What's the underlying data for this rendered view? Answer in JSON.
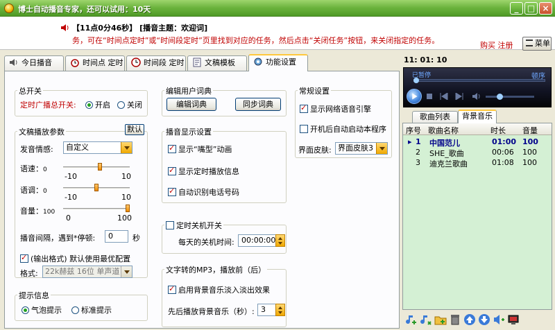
{
  "window": {
    "title": "博士自动播音专家，还可以试用：10天"
  },
  "notice": {
    "line1": "【11点0分46秒】 [播音主题：欢迎词]",
    "line2": "务，可在“时间点定时”或“时间段定时”页里找到对应的任务，然后点击“关闭任务”按钮，来关闭指定的任务。",
    "buy": "购买",
    "register": "注册",
    "menu": "菜单"
  },
  "tabs": [
    {
      "label": "今日播音",
      "icon": "speaker-icon"
    },
    {
      "label": "时间点 定时",
      "icon": "alarm-clock-icon"
    },
    {
      "label": "时间段 定时",
      "icon": "clock-icon"
    },
    {
      "label": "文稿模板",
      "icon": "document-icon"
    },
    {
      "label": "功能设置",
      "icon": "gear-icon",
      "active": true
    }
  ],
  "master": {
    "title": "总开关",
    "label": "定时广播总开关:",
    "on": "开启",
    "off": "关闭",
    "selected": "on"
  },
  "playback": {
    "title": "文稿播放参数",
    "default_btn": "默认",
    "emotion_label": "发音情感:",
    "emotion_value": "自定义",
    "speed": {
      "label": "语速：",
      "zero": "0",
      "min": "-10",
      "max": "10",
      "value": 1
    },
    "pitch": {
      "label": "语调：",
      "zero": "0",
      "min": "-10",
      "max": "10",
      "value": 0
    },
    "volume": {
      "label": "音量：",
      "hundred": "100",
      "min": "0",
      "max": "100",
      "value": 100
    },
    "interval_label": "播音间隔，遇到*停顿:",
    "interval_value": "0",
    "interval_unit": "秒",
    "output_check": "(输出格式) 默认使用最优配置",
    "format_label": "格式:",
    "format_value": "22k赫兹 16位 单声道"
  },
  "tips": {
    "title": "提示信息",
    "bubble": "气泡提示",
    "standard": "标准提示",
    "selected": "bubble"
  },
  "dict": {
    "title": "编辑用户词典",
    "edit": "编辑词典",
    "sync": "同步词典"
  },
  "display": {
    "title": "播音显示设置",
    "anim": "显示“嘴型”动画",
    "timed": "显示定时播放信息",
    "phone": "自动识别电话号码"
  },
  "shutdown": {
    "title": "定时关机开关",
    "label": "每天的关机时间:",
    "time": "00:00:00"
  },
  "mp3": {
    "title": "文字转的MP3，播放前（后）",
    "bgm": "启用背景音乐淡入淡出效果",
    "seconds_label": "先后播放背景音乐（秒）:",
    "seconds": "3"
  },
  "general": {
    "title": "常规设置",
    "engine": "显示网络语音引擎",
    "autostart": "开机后自动启动本程序",
    "skin_label": "界面皮肤:",
    "skin_value": "界面皮肤3"
  },
  "right": {
    "clock": "11: 01: 10",
    "player_status": "已暂停",
    "player_mode": "顿序",
    "subtabs": [
      "歌曲列表",
      "背景音乐"
    ],
    "columns": [
      "序号",
      "歌曲名称",
      "时长",
      "音量"
    ],
    "rows": [
      {
        "no": "1",
        "name": "中国范儿",
        "dur": "01:00",
        "vol": "100",
        "selected": true
      },
      {
        "no": "2",
        "name": "SHE_歌曲",
        "dur": "00:06",
        "vol": "100"
      },
      {
        "no": "3",
        "name": "迪克兰歌曲",
        "dur": "01:08",
        "vol": "100"
      }
    ]
  },
  "colors": {
    "accent": "#6ab23c",
    "alert": "#c00000",
    "list_bg": "#d4f0d4"
  }
}
